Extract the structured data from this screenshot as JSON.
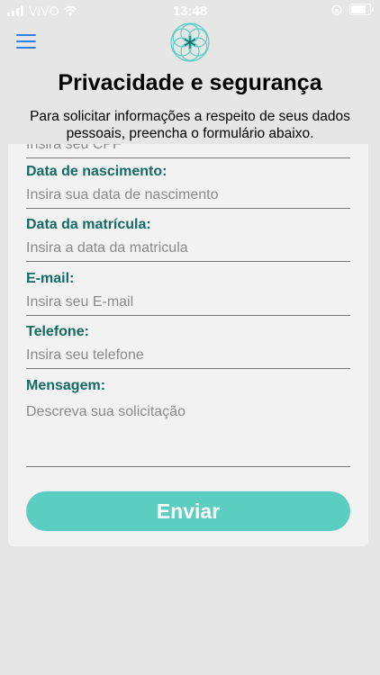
{
  "status": {
    "carrier": "VIVO",
    "time": "13:48",
    "battery_level": 0.8
  },
  "header": {
    "menu_icon": "hamburger-menu-icon",
    "logo_icon": "flower-of-life-logo",
    "title": "Privacidade e segurança",
    "intro": "Para solicitar informações a respeito de seus dados pessoais, preencha o formulário abaixo."
  },
  "form": {
    "cpf": {
      "placeholder": "Insira seu CPF"
    },
    "birth": {
      "label": "Data de nascimento:",
      "placeholder": "Insira sua data de nascimento"
    },
    "enroll": {
      "label": "Data da matrícula:",
      "placeholder": "Insira a data da matricula"
    },
    "email": {
      "label": "E-mail:",
      "placeholder": "Insira seu E-mail"
    },
    "phone": {
      "label": "Telefone:",
      "placeholder": "Insira seu telefone"
    },
    "message": {
      "label": "Mensagem:",
      "placeholder": "Descreva sua solicitação"
    },
    "submit_label": "Enviar"
  },
  "colors": {
    "accent": "#5ccdc1",
    "label": "#146b63",
    "menu": "#2f80ed"
  }
}
